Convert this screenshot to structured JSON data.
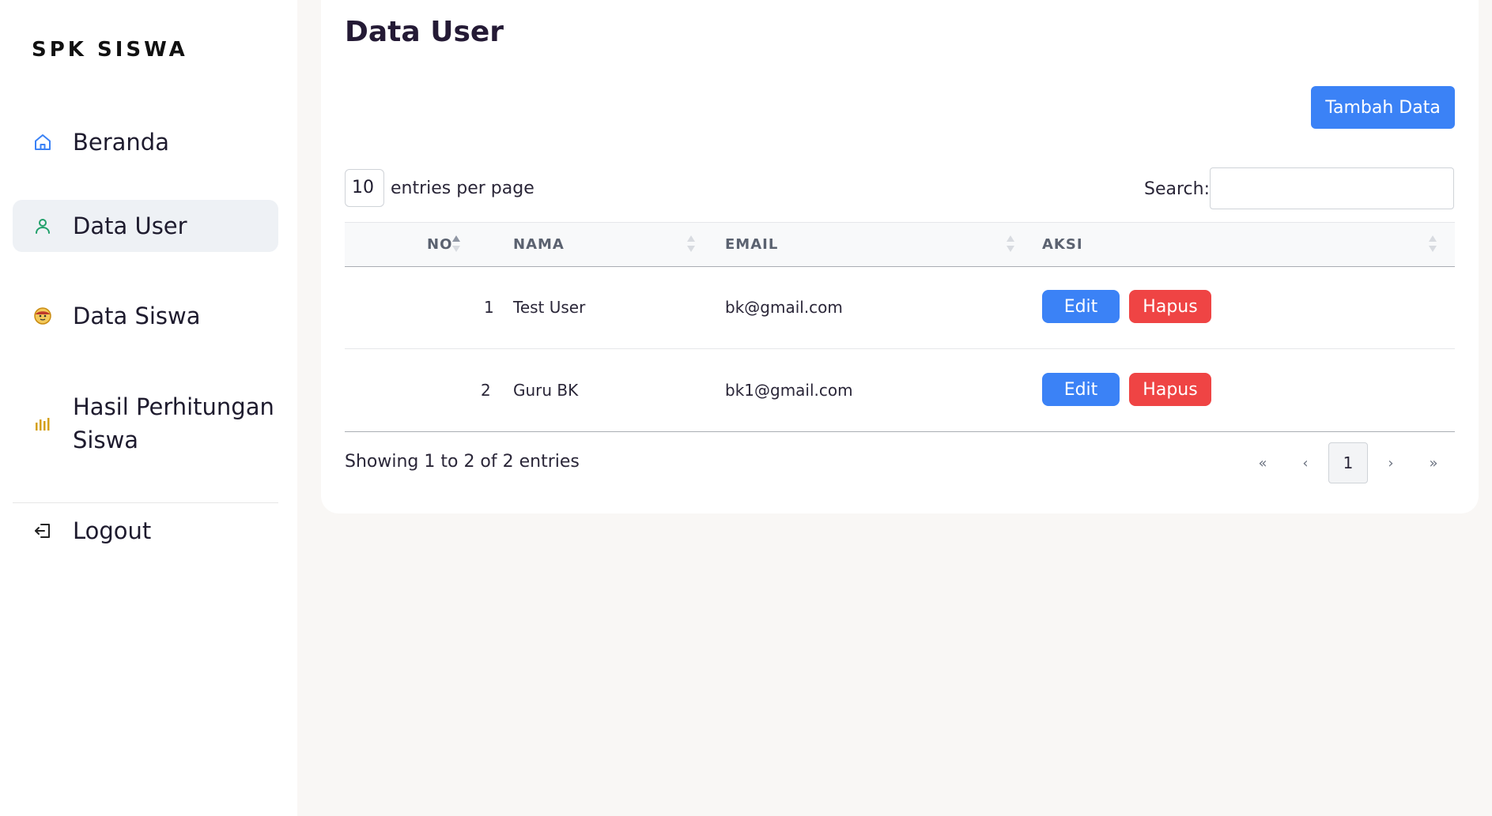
{
  "sidebar": {
    "brand": "SPK SISWA",
    "items": [
      {
        "label": "Beranda",
        "icon": "home-icon"
      },
      {
        "label": "Data User",
        "icon": "user-icon",
        "active": true
      },
      {
        "label": "Data Siswa",
        "icon": "student-face-icon"
      },
      {
        "label": "Hasil Perhitungan Siswa",
        "icon": "bar-chart-icon"
      }
    ],
    "logout": {
      "label": "Logout",
      "icon": "logout-icon"
    }
  },
  "main": {
    "title": "Data User",
    "add_button": "Tambah Data",
    "entries_value": "10",
    "entries_label": "entries per page",
    "search_label": "Search:",
    "search_value": "",
    "table": {
      "columns": [
        "NO",
        "NAMA",
        "EMAIL",
        "AKSI"
      ],
      "rows": [
        {
          "no": "1",
          "nama": "Test User",
          "email": "bk@gmail.com",
          "edit": "Edit",
          "hapus": "Hapus"
        },
        {
          "no": "2",
          "nama": "Guru BK",
          "email": "bk1@gmail.com",
          "edit": "Edit",
          "hapus": "Hapus"
        }
      ]
    },
    "showing": "Showing 1 to 2 of 2 entries",
    "pagination": {
      "first": "«",
      "prev": "‹",
      "current": "1",
      "next": "›",
      "last": "»"
    }
  },
  "colors": {
    "primary": "#3b82f6",
    "danger": "#ef4444",
    "sidebar_active_bg": "#eef1f5",
    "icon_home": "#3b82f6",
    "icon_user": "#22a06b",
    "icon_student": "#e0a21b",
    "icon_chart": "#d4a017"
  }
}
